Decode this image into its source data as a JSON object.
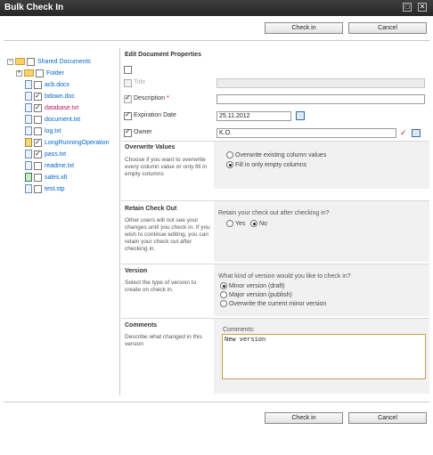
{
  "window": {
    "title": "Bulk Check In",
    "maximize_glyph": "□",
    "close_glyph": "✕"
  },
  "buttons": {
    "checkin": "Check in",
    "cancel": "Cancel"
  },
  "tree": {
    "root": "Shared Documents",
    "items": [
      {
        "label": "Folder",
        "icon": "folder-icon",
        "checked": false
      },
      {
        "label": "acb.docx",
        "icon": "document-icon",
        "checked": false
      },
      {
        "label": "bdown.doc",
        "icon": "document-icon",
        "checked": true
      },
      {
        "label": "database.txt",
        "icon": "text-file-icon",
        "checked": true
      },
      {
        "label": "document.txt",
        "icon": "text-file-icon",
        "checked": false
      },
      {
        "label": "log.txt",
        "icon": "text-file-icon",
        "checked": false
      },
      {
        "label": "LongRunningOperation",
        "icon": "locked-file-icon",
        "checked": true
      },
      {
        "label": "pass.txt",
        "icon": "text-file-icon",
        "checked": true
      },
      {
        "label": "readme.txt",
        "icon": "text-file-icon",
        "checked": false
      },
      {
        "label": "sales.xlt",
        "icon": "excel-icon",
        "checked": false
      },
      {
        "label": "test.stp",
        "icon": "text-file-icon",
        "checked": false
      }
    ]
  },
  "properties": {
    "heading": "Edit Document Properties",
    "title_label": "Title",
    "description_label": "Description",
    "required_mark": "*",
    "expiration_label": "Expiration Date",
    "expiration_value": "25.11.2012",
    "owner_label": "Owner",
    "owner_value": "K.O."
  },
  "overwrite": {
    "heading": "Overwrite Values",
    "desc": "Choose if you want to overwrite every column value or only fill in empty columns",
    "options": [
      "Overwrite existing column values",
      "Fill in only empty columns"
    ],
    "selected": 1
  },
  "retain": {
    "heading": "Retain Check Out",
    "desc": "Other users will not see your changes until you check in. If you wish to continue editing, you can retain your check out after checking in.",
    "question": "Retain your check out after checking in?",
    "yes": "Yes",
    "no": "No",
    "selected": "No"
  },
  "version": {
    "heading": "Version",
    "desc": "Select the type of version to create on check in.",
    "question": "What kind of version would you like to check in?",
    "options": [
      "Minor version (draft)",
      "Major version (publish)",
      "Overwrite the current minor version"
    ],
    "selected": 0
  },
  "comments": {
    "heading": "Comments",
    "desc": "Describe what changed in this version",
    "label": "Comments:",
    "value": "New version"
  }
}
